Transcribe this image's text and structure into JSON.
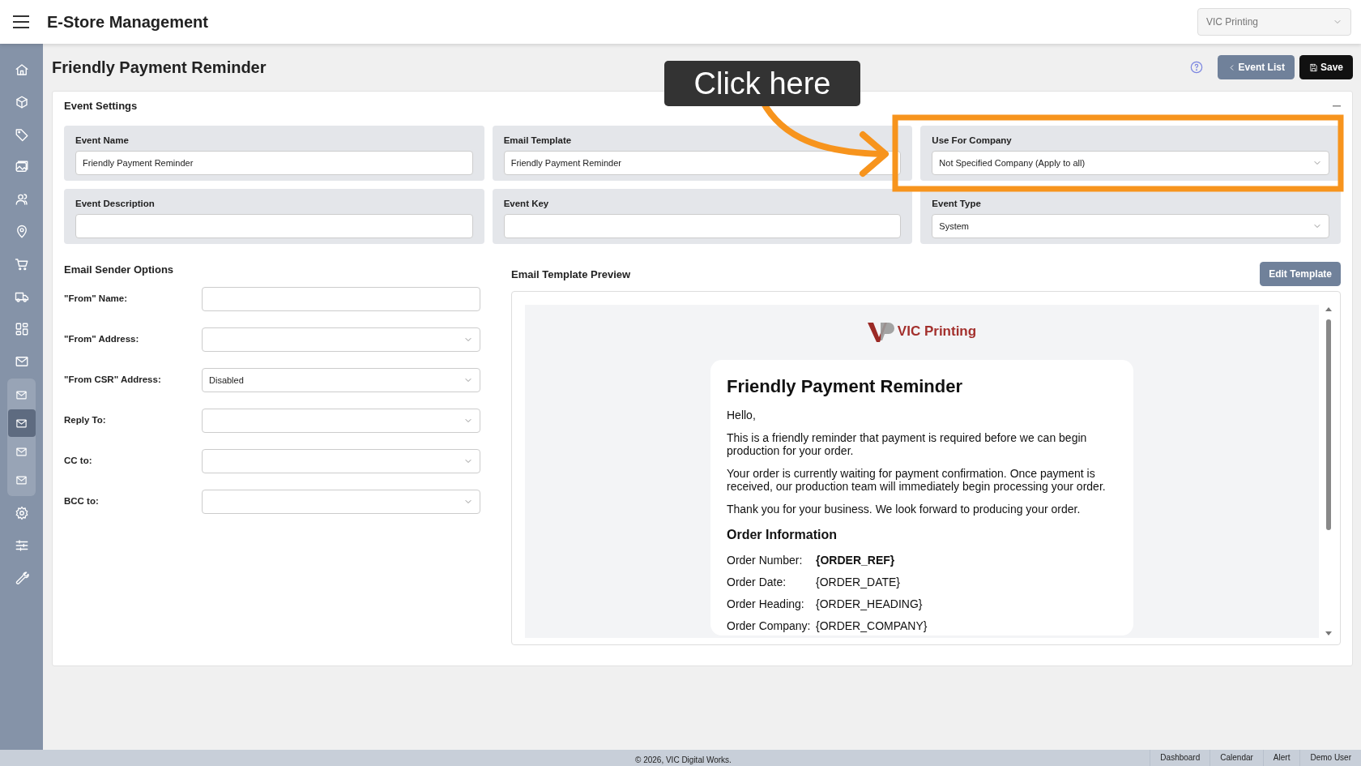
{
  "app": {
    "title": "E-Store Management",
    "company_select": {
      "value": "VIC Printing"
    }
  },
  "sidebar": {
    "items": [
      {
        "selected": false
      },
      {
        "selected": false
      },
      {
        "selected": false
      },
      {
        "selected": false
      },
      {
        "selected": false
      },
      {
        "selected": false
      },
      {
        "selected": false
      },
      {
        "selected": false
      },
      {
        "selected": false
      },
      {
        "selected": false,
        "expanded": true,
        "children": [
          {
            "selected": false
          },
          {
            "selected": true
          },
          {
            "selected": false
          },
          {
            "selected": false
          }
        ]
      },
      {
        "selected": false
      },
      {
        "selected": false
      },
      {
        "selected": false
      }
    ]
  },
  "page": {
    "title": "Friendly Payment Reminder",
    "buttons": [
      {
        "label": "Event List",
        "kind": "back"
      },
      {
        "label": "Save",
        "kind": "save"
      }
    ]
  },
  "event_settings": {
    "title": "Event Settings",
    "fields": [
      {
        "label": "Event Name",
        "kind": "text",
        "value": "Friendly Payment Reminder"
      },
      {
        "label": "Email Template",
        "kind": "text",
        "value": "Friendly Payment Reminder"
      },
      {
        "label": "Use For Company",
        "kind": "select",
        "value": "Not Specified Company (Apply to all)"
      },
      {
        "label": "Event Description",
        "kind": "text"
      },
      {
        "label": "Event Key",
        "kind": "text"
      },
      {
        "label": "Event Type",
        "kind": "select",
        "value": "System"
      }
    ]
  },
  "sender_options": {
    "title": "Email Sender Options",
    "fields": [
      {
        "label": "\"From\" Name:",
        "kind": "text"
      },
      {
        "label": "\"From\" Address:",
        "kind": "select"
      },
      {
        "label": "\"From CSR\" Address:",
        "kind": "select",
        "value": "Disabled"
      },
      {
        "label": "Reply To:",
        "kind": "select"
      },
      {
        "label": "CC to:",
        "kind": "select"
      },
      {
        "label": "BCC to:",
        "kind": "select"
      }
    ]
  },
  "preview": {
    "title": "Email Template Preview",
    "edit_button": "Edit Template",
    "email": {
      "logo_text": "VIC Printing",
      "heading": "Friendly Payment Reminder",
      "paragraphs": [
        "Hello,",
        "This is a friendly reminder that payment is required before we can begin production for your order.",
        "Your order is currently waiting for payment confirmation. Once payment is received, our production team will immediately begin processing your order.",
        "Thank you for your business. We look forward to producing your order."
      ],
      "section_title": "Order Information",
      "rows": [
        {
          "label": "Order Number:",
          "value": "{ORDER_REF}",
          "bold": true
        },
        {
          "label": "Order Date:",
          "value": "{ORDER_DATE}",
          "bold": false
        },
        {
          "label": "Order Heading:",
          "value": "{ORDER_HEADING}",
          "bold": false
        },
        {
          "label": "Order Company:",
          "value": "{ORDER_COMPANY}",
          "bold": false
        }
      ]
    }
  },
  "annotation": {
    "callout": "Click here"
  },
  "footer": {
    "copyright": "© 2026, VIC Digital Works.",
    "links": [
      "Dashboard",
      "Calendar",
      "Alert",
      "Demo User"
    ]
  }
}
